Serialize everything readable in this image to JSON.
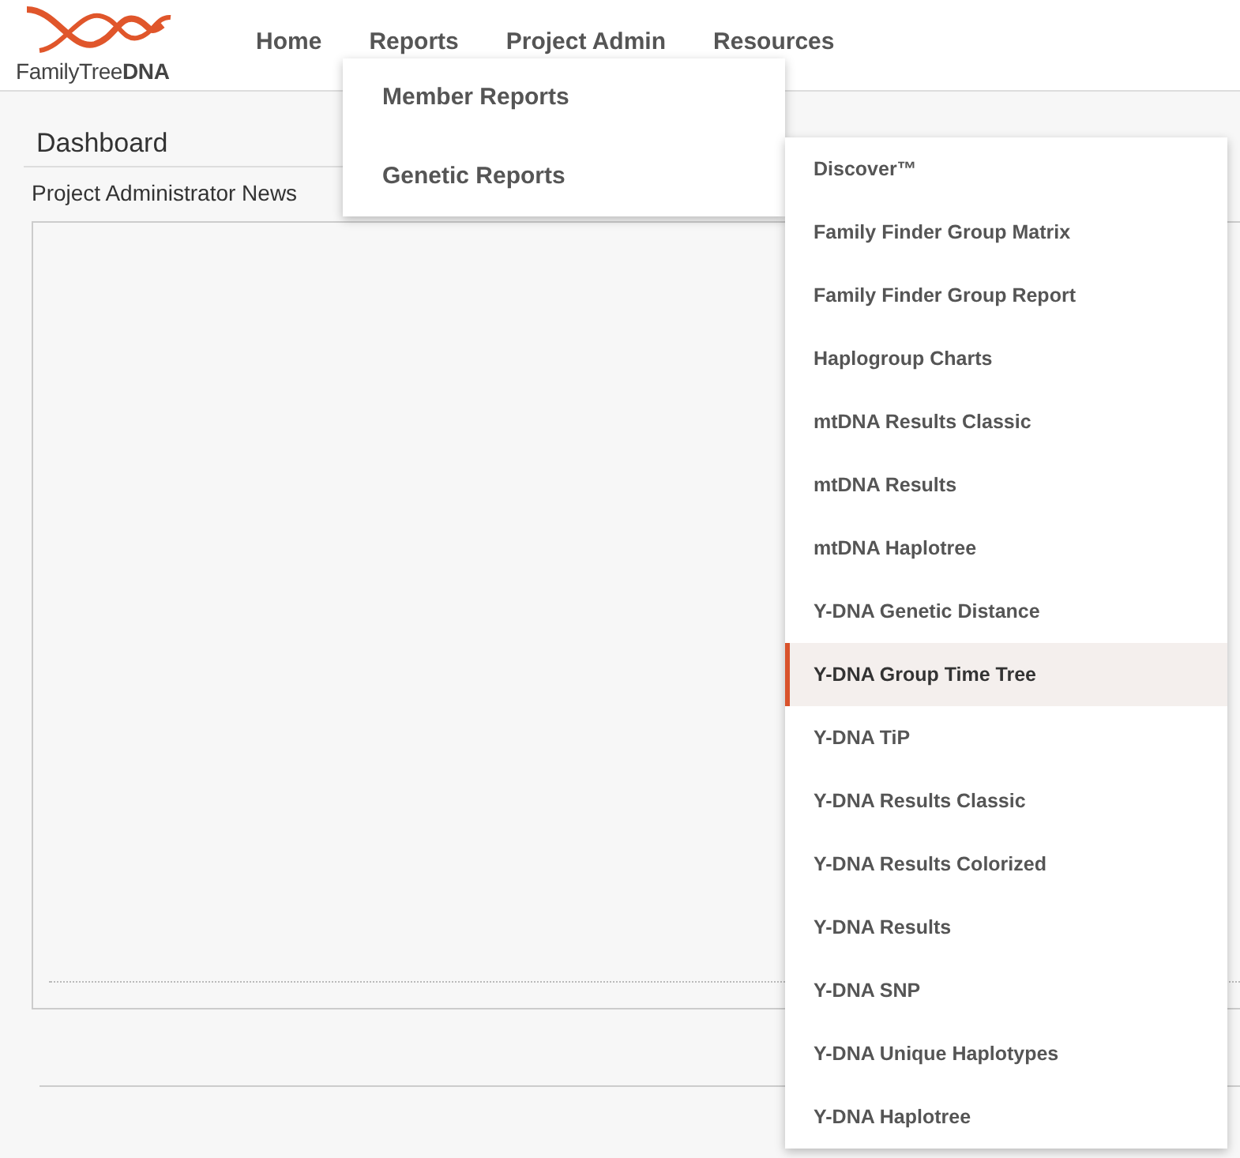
{
  "logo": {
    "name_regular": "FamilyTree",
    "name_bold": "DNA"
  },
  "nav": [
    "Home",
    "Reports",
    "Project Admin",
    "Resources"
  ],
  "page": {
    "title": "Dashboard",
    "section": "Project Administrator News"
  },
  "reports_menu": [
    "Member Reports",
    "Genetic Reports"
  ],
  "genetic_reports_menu": [
    {
      "label": "Discover™",
      "selected": false
    },
    {
      "label": "Family Finder Group Matrix",
      "selected": false
    },
    {
      "label": "Family Finder Group Report",
      "selected": false
    },
    {
      "label": "Haplogroup Charts",
      "selected": false
    },
    {
      "label": "mtDNA Results Classic",
      "selected": false
    },
    {
      "label": "mtDNA Results",
      "selected": false
    },
    {
      "label": "mtDNA Haplotree",
      "selected": false
    },
    {
      "label": "Y-DNA Genetic Distance",
      "selected": false
    },
    {
      "label": "Y-DNA Group Time Tree",
      "selected": true
    },
    {
      "label": "Y-DNA TiP",
      "selected": false
    },
    {
      "label": "Y-DNA Results Classic",
      "selected": false
    },
    {
      "label": "Y-DNA Results Colorized",
      "selected": false
    },
    {
      "label": "Y-DNA Results",
      "selected": false
    },
    {
      "label": "Y-DNA SNP",
      "selected": false
    },
    {
      "label": "Y-DNA Unique Haplotypes",
      "selected": false
    },
    {
      "label": "Y-DNA Haplotree",
      "selected": false
    }
  ]
}
